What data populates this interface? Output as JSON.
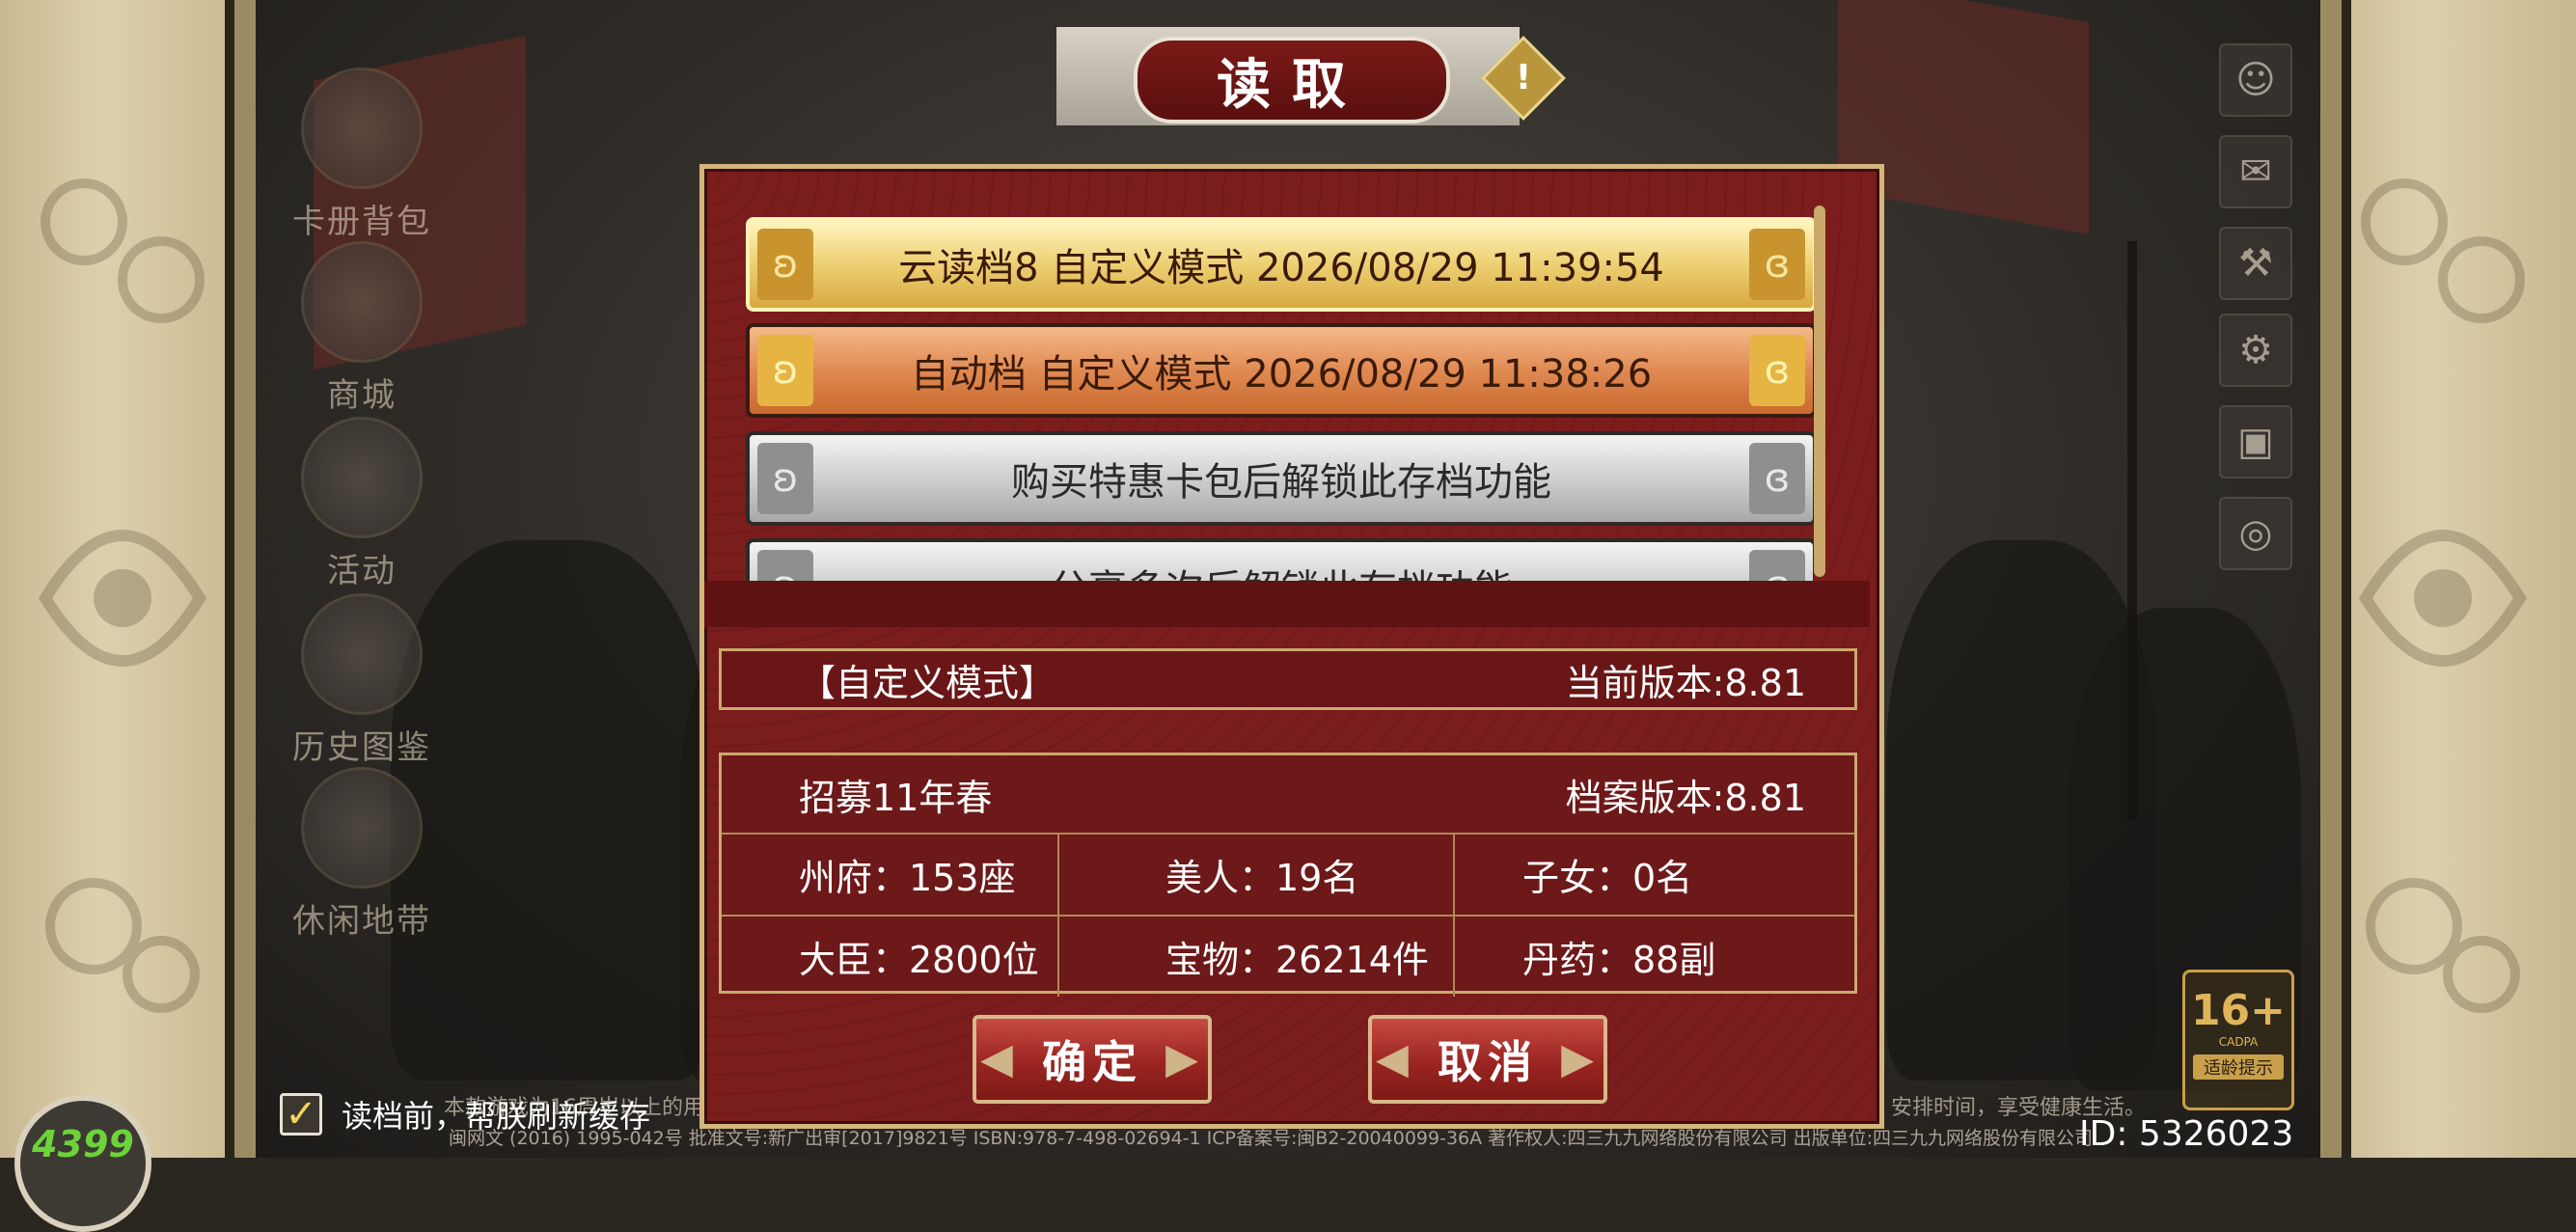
{
  "dialog": {
    "title": "读取",
    "warn_glyph": "!"
  },
  "slots": [
    {
      "label": "云读档8  自定义模式  2026/08/29 11:39:54",
      "style": "gold"
    },
    {
      "label": "自动档  自定义模式  2026/08/29 11:38:26",
      "style": "orange"
    },
    {
      "label": "购买特惠卡包后解锁此存档功能",
      "style": "grey"
    },
    {
      "label": "分享多次后解锁此存档功能",
      "style": "grey"
    }
  ],
  "mode_bar": {
    "mode": "【自定义模式】",
    "current_version": "当前版本:8.81"
  },
  "info": {
    "period": "招募11年春",
    "save_version": "档案版本:8.81",
    "stats": [
      "州府：153座",
      "美人：19名",
      "子女：0名",
      "大臣：2800位",
      "宝物：26214件",
      "丹药：88副"
    ]
  },
  "buttons": {
    "confirm": "确定",
    "cancel": "取消"
  },
  "left_menu": [
    "卡册背包",
    "商城",
    "活动",
    "历史图鉴",
    "休闲地带"
  ],
  "right_menu_icons": [
    "avatar-icon",
    "mail-icon",
    "hammer-icon",
    "gear-icon",
    "gift-icon",
    "eye-off-icon"
  ],
  "checkbox": {
    "checked": true,
    "label": "读档前，帮朕刷新缓存"
  },
  "footer": {
    "notice_left": "本款游戏为16周岁以上的用户",
    "notice_right": "安排时间，享受健康生活。",
    "copyright": "闽网文 (2016) 1995-042号  批准文号:新广出审[2017]9821号  ISBN:978-7-498-02694-1 ICP备案号:闽B2-20040099-36A  著作权人:四三九九网络股份有限公司  出版单位:四三九九网络股份有限公司",
    "id": "ID: 5326023"
  },
  "age_rating": {
    "age": "16+",
    "org": "CADPA",
    "tip": "适龄提示"
  },
  "logo": "4399"
}
